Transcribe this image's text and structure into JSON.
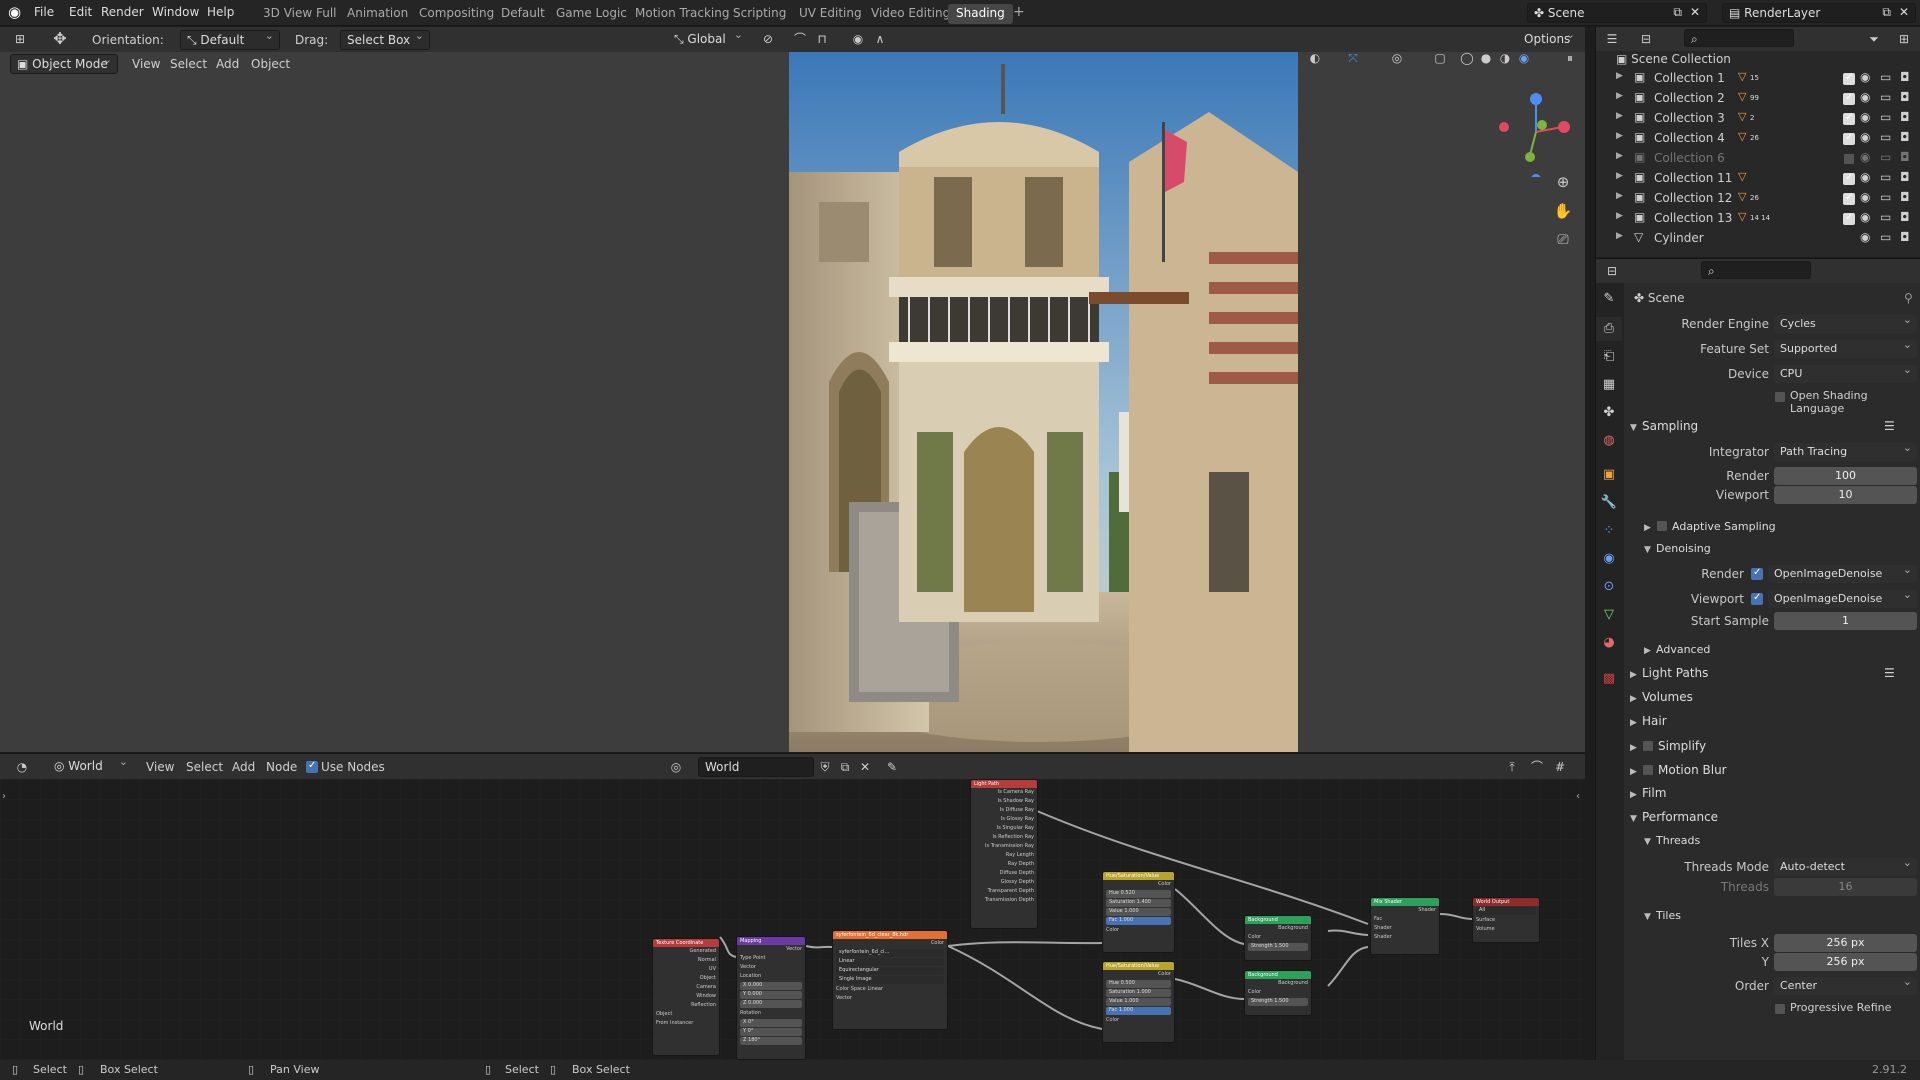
{
  "menubar": {
    "logo": "blender-logo-icon",
    "items": [
      "File",
      "Edit",
      "Render",
      "Window",
      "Help"
    ],
    "workspaces": [
      "3D View Full",
      "Animation",
      "Compositing",
      "Default",
      "Game Logic",
      "Motion Tracking",
      "Scripting",
      "UV Editing",
      "Video Editing",
      "Shading"
    ],
    "active_workspace": "Shading",
    "add_tab": "+",
    "scene": "Scene",
    "view_layer": "RenderLayer"
  },
  "viewport_header": {
    "orientation_label": "Orientation:",
    "orientation_value": "Default",
    "drag_label": "Drag:",
    "drag_value": "Select Box",
    "transform": "Global",
    "options": "Options"
  },
  "viewport_menu": {
    "mode": "Object Mode",
    "items": [
      "View",
      "Select",
      "Add",
      "Object"
    ]
  },
  "node_editor": {
    "type": "World",
    "items": [
      "View",
      "Select",
      "Add",
      "Node"
    ],
    "use_nodes_label": "Use Nodes",
    "use_nodes_checked": true,
    "world_name": "World",
    "corner_label": "World",
    "nodes": {
      "light_path": {
        "title": "Light Path",
        "outputs": [
          "Is Camera Ray",
          "Is Shadow Ray",
          "Is Diffuse Ray",
          "Is Glossy Ray",
          "Is Singular Ray",
          "Is Reflection Ray",
          "Is Transmission Ray",
          "Ray Length",
          "Ray Depth",
          "Diffuse Depth",
          "Glossy Depth",
          "Transparent Depth",
          "Transmission Depth"
        ]
      },
      "tex_coord": {
        "title": "Texture Coordinate",
        "outputs": [
          "Generated",
          "Normal",
          "UV",
          "Object",
          "Camera",
          "Window",
          "Reflection"
        ],
        "object_label": "Object",
        "from_instancer": "From Instancer"
      },
      "mapping": {
        "title": "Mapping",
        "output": "Vector",
        "type_label": "Type",
        "type_value": "Point",
        "inputs": [
          "Vector",
          "Location"
        ],
        "loc": [
          "X",
          "Y",
          "Z"
        ],
        "loc_vals": [
          "0.000",
          "0.000",
          "0.000"
        ],
        "rotation": "Rotation",
        "rot": [
          "X",
          "Y",
          "Z"
        ],
        "rot_vals": [
          "0°",
          "0°",
          "180°"
        ]
      },
      "env_tex": {
        "title": "syferfontein_6d_clear_8k.hdr",
        "output": "Color",
        "file": "syferfontein_6d_cl...",
        "rows": [
          "Linear",
          "Equirectangular",
          "Single Image"
        ],
        "colorspace_label": "Color Space",
        "colorspace": "Linear",
        "input": "Vector"
      },
      "hsv1": {
        "title": "Hue/Saturation/Value",
        "output": "Color",
        "rows": [
          "Hue",
          "Saturation",
          "Value",
          "Fac"
        ],
        "vals": [
          "0.520",
          "1.400",
          "1.000",
          "1.000"
        ],
        "input": "Color"
      },
      "hsv2": {
        "title": "Hue/Saturation/Value",
        "output": "Color",
        "rows": [
          "Hue",
          "Saturation",
          "Value",
          "Fac"
        ],
        "vals": [
          "0.500",
          "1.000",
          "1.000",
          "1.000"
        ],
        "input": "Color"
      },
      "bg1": {
        "title": "Background",
        "output": "Background",
        "input": "Color",
        "strength_label": "Strength",
        "strength": "1.500"
      },
      "bg2": {
        "title": "Background",
        "output": "Background",
        "input": "Color",
        "strength_label": "Strength",
        "strength": "1.500"
      },
      "mix": {
        "title": "Mix Shader",
        "output": "Shader",
        "inputs": [
          "Fac",
          "Shader",
          "Shader"
        ]
      },
      "out": {
        "title": "World Output",
        "target": "All",
        "inputs": [
          "Surface",
          "Volume"
        ]
      }
    }
  },
  "outliner": {
    "root": "Scene Collection",
    "rows": [
      {
        "name": "Collection 1",
        "badge": "15",
        "visible": true
      },
      {
        "name": "Collection 2",
        "badge": "99",
        "visible": true
      },
      {
        "name": "Collection 3",
        "badge": "2",
        "visible": true
      },
      {
        "name": "Collection 4",
        "badge": "26",
        "visible": true
      },
      {
        "name": "Collection 6",
        "badge": "",
        "visible": false
      },
      {
        "name": "Collection 11",
        "badge": "",
        "visible": true
      },
      {
        "name": "Collection 12",
        "badge": "26",
        "visible": true
      },
      {
        "name": "Collection 13",
        "badge": "14 14",
        "visible": true
      },
      {
        "name": "Cylinder",
        "badge": "",
        "visible": true
      }
    ]
  },
  "properties": {
    "context": "Scene",
    "render_engine_label": "Render Engine",
    "render_engine": "Cycles",
    "feature_set_label": "Feature Set",
    "feature_set": "Supported",
    "device_label": "Device",
    "device": "CPU",
    "osl_label": "Open Shading Language",
    "sampling": "Sampling",
    "integrator_label": "Integrator",
    "integrator": "Path Tracing",
    "render_label": "Render",
    "render_samples": "100",
    "viewport_label": "Viewport",
    "viewport_samples": "10",
    "adaptive": "Adaptive Sampling",
    "denoising": "Denoising",
    "denoise_render": "OpenImageDenoise",
    "denoise_viewport": "OpenImageDenoise",
    "start_sample_label": "Start Sample",
    "start_sample": "1",
    "advanced": "Advanced",
    "panels": [
      "Light Paths",
      "Volumes",
      "Hair",
      "Simplify",
      "Motion Blur",
      "Film",
      "Performance"
    ],
    "threads": "Threads",
    "threads_mode_label": "Threads Mode",
    "threads_mode": "Auto-detect",
    "threads_count_label": "Threads",
    "threads_count": "16",
    "tiles": "Tiles",
    "tiles_x_label": "Tiles X",
    "tiles_x": "256 px",
    "tiles_y_label": "Y",
    "tiles_y": "256 px",
    "order_label": "Order",
    "order": "Center",
    "progressive": "Progressive Refine"
  },
  "statusbar": {
    "items": [
      "Select",
      "Box Select",
      "Pan View",
      "Select",
      "Box Select"
    ],
    "version": "2.91.2"
  },
  "colors": {
    "accent": "#4772b3",
    "active_tab": "#474747",
    "node_texture": "#e36f33",
    "node_converter": "#6c3aa5",
    "node_input": "#b43c3c",
    "node_color": "#b8a32d",
    "node_shader": "#2fa05c",
    "node_output": "#8e2c2c"
  }
}
